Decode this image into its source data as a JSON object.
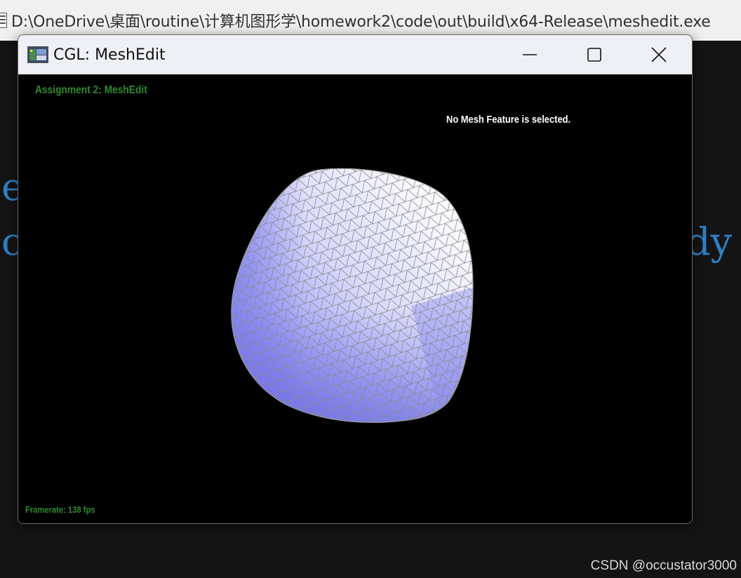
{
  "console": {
    "path": "D:\\OneDrive\\桌面\\routine\\计算机图形学\\homework2\\code\\out\\build\\x64-Release\\meshedit.exe"
  },
  "background_fragments": {
    "line1": "e",
    "line2_left": "c",
    "line2_right": "dy"
  },
  "window": {
    "title": "CGL: MeshEdit",
    "icon": "app-window-icon",
    "buttons": {
      "minimize": "minimize-icon",
      "maximize": "maximize-icon",
      "close": "close-icon"
    }
  },
  "viewport": {
    "label": "Assignment 2: MeshEdit",
    "selection_status": "No Mesh Feature is selected.",
    "framerate": "Framerate: 138 fps"
  },
  "colors": {
    "label_green": "#2e8b2e",
    "mesh_light": "#f4f4ff",
    "mesh_dark": "#7f7ff5",
    "wireframe": "#8a8a8a",
    "background_blue_text": "#2f7fc8"
  },
  "watermark": "CSDN @occustator3000"
}
